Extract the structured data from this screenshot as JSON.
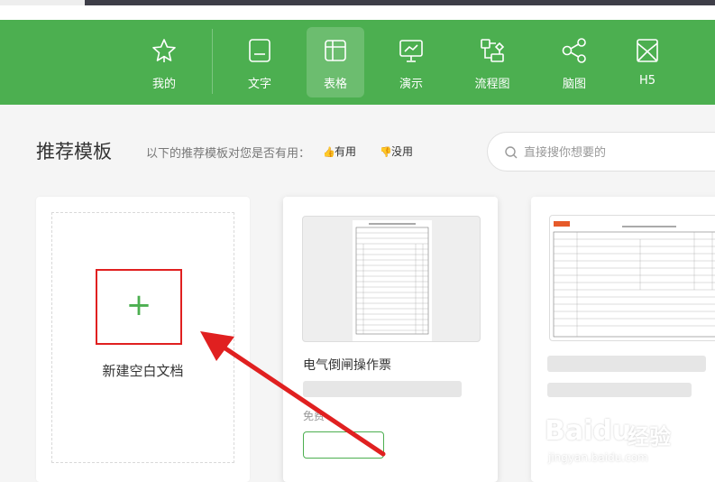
{
  "nav": {
    "items": [
      {
        "label": "我的",
        "icon": "star-icon",
        "active": false
      },
      {
        "label": "文字",
        "icon": "document-icon",
        "active": false
      },
      {
        "label": "表格",
        "icon": "table-icon",
        "active": true
      },
      {
        "label": "演示",
        "icon": "presentation-icon",
        "active": false
      },
      {
        "label": "流程图",
        "icon": "flowchart-icon",
        "active": false
      },
      {
        "label": "脑图",
        "icon": "mindmap-icon",
        "active": false
      },
      {
        "label": "H5",
        "icon": "h5-icon",
        "active": false
      }
    ],
    "background": "#4caf50"
  },
  "recommend": {
    "title": "推荐模板",
    "feedback_prompt": "以下的推荐模板对您是否有用：",
    "useful_label": "有用",
    "useless_label": "没用"
  },
  "search": {
    "placeholder": "直接搜你想要的"
  },
  "cards": {
    "blank": {
      "label": "新建空白文档"
    },
    "template1": {
      "title": "电气倒闸操作票",
      "price_label": "免费"
    }
  },
  "watermark": {
    "brand": "Baidu",
    "brand_cn": "经验",
    "url": "jingyan.baidu.com"
  },
  "colors": {
    "accent": "#4caf50",
    "highlight_box": "#e02020",
    "arrow": "#e02020"
  }
}
